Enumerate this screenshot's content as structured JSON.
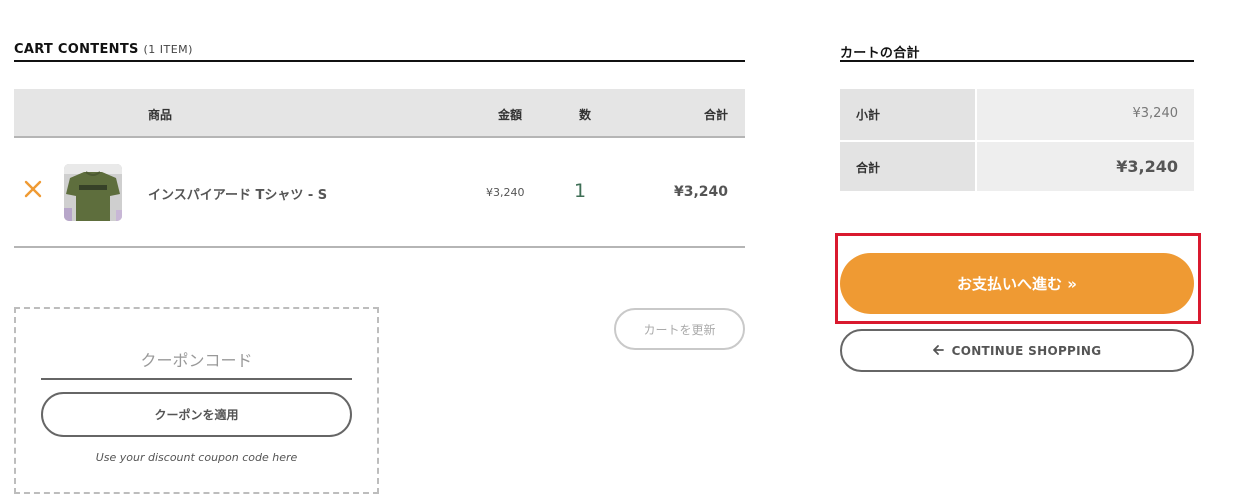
{
  "cart": {
    "title": "CART CONTENTS",
    "count": "(1 ITEM)",
    "columns": {
      "product": "商品",
      "price": "金額",
      "qty": "数",
      "total": "合計"
    },
    "items": [
      {
        "name": "インスパイアード Tシャツ - S",
        "price": "¥3,240",
        "qty": "1",
        "total": "¥3,240"
      }
    ],
    "update_label": "カートを更新"
  },
  "coupon": {
    "placeholder": "クーポンコード",
    "apply_label": "クーポンを適用",
    "help": "Use your discount coupon code here"
  },
  "totals": {
    "title": "カートの合計",
    "subtotal_label": "小計",
    "subtotal_value": "¥3,240",
    "total_label": "合計",
    "total_value": "¥3,240"
  },
  "actions": {
    "checkout_label": "お支払いへ進む »",
    "continue_label": "CONTINUE SHOPPING"
  },
  "icons": {
    "remove": "close-icon",
    "back": "arrow-left-icon"
  },
  "colors": {
    "accent": "#ef9a33",
    "highlight": "#d9192e",
    "qty": "#3e6e55"
  }
}
